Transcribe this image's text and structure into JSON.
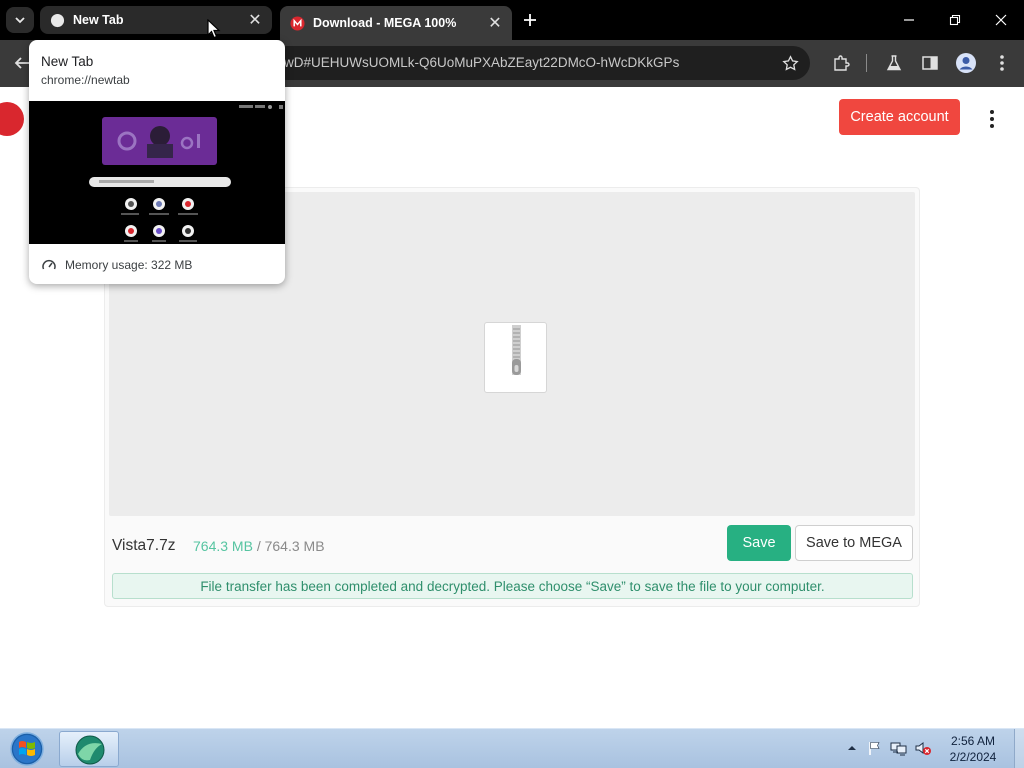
{
  "browser": {
    "tabs": [
      {
        "title": "New Tab",
        "active": false
      },
      {
        "title": "Download - MEGA 100%",
        "active": true
      }
    ],
    "url": "wD#UEHUWsUOMLk-Q6UoMuPXAbZEayt22DMcO-hWcDKkGPs"
  },
  "hovercard": {
    "title": "New Tab",
    "url": "chrome://newtab",
    "memory": "Memory usage: 322 MB"
  },
  "page": {
    "create_account": "Create account",
    "file": {
      "name": "Vista7.7z",
      "downloaded": "764.3 MB",
      "separator": "/",
      "total": "764.3 MB"
    },
    "save_label": "Save",
    "save_to_mega_label": "Save to MEGA",
    "notice": "File transfer has been completed and decrypted. Please choose “Save” to save the file to your computer."
  },
  "taskbar": {
    "time": "2:56 AM",
    "date": "2/2/2024"
  },
  "colors": {
    "mega_red": "#d9272e",
    "create_button": "#f0473f",
    "save_button": "#27b082",
    "progress_done": "#56c4a1"
  }
}
